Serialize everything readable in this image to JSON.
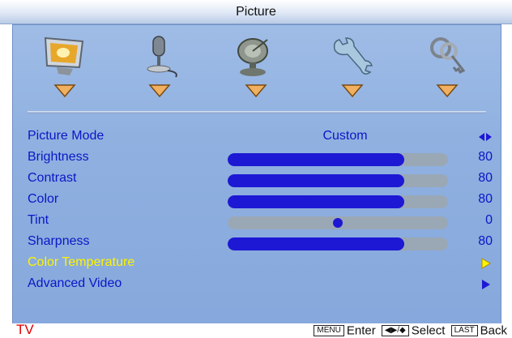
{
  "window": {
    "title": "Picture"
  },
  "categories": [
    {
      "icon": "monitor-icon"
    },
    {
      "icon": "microphone-icon"
    },
    {
      "icon": "satellite-dish-icon"
    },
    {
      "icon": "wrench-icon"
    },
    {
      "icon": "keys-icon"
    }
  ],
  "menu": {
    "rows": [
      {
        "label": "Picture Mode",
        "value": "Custom",
        "control": "toggle"
      },
      {
        "label": "Brightness",
        "value": "80",
        "level": 0.8,
        "control": "bar"
      },
      {
        "label": "Contrast",
        "value": "80",
        "level": 0.8,
        "control": "bar"
      },
      {
        "label": "Color",
        "value": "80",
        "level": 0.8,
        "control": "bar"
      },
      {
        "label": "Tint",
        "value": "0",
        "level": 0.5,
        "control": "dot"
      },
      {
        "label": "Sharpness",
        "value": "80",
        "level": 0.8,
        "control": "bar"
      },
      {
        "label": "Color Temperature",
        "control": "submenu",
        "highlight": true
      },
      {
        "label": "Advanced Video",
        "control": "submenu"
      }
    ]
  },
  "footer": {
    "source": "TV",
    "keys": [
      {
        "key": "MENU",
        "action": "Enter"
      },
      {
        "key": "◀▶/◆",
        "action": "Select"
      },
      {
        "key": "LAST",
        "action": "Back"
      }
    ]
  },
  "colors": {
    "label": "#0a17c6",
    "highlight": "#fff400",
    "barFill": "#1d18d4",
    "barTrack": "#9aa8b6",
    "source": "#e00000"
  }
}
